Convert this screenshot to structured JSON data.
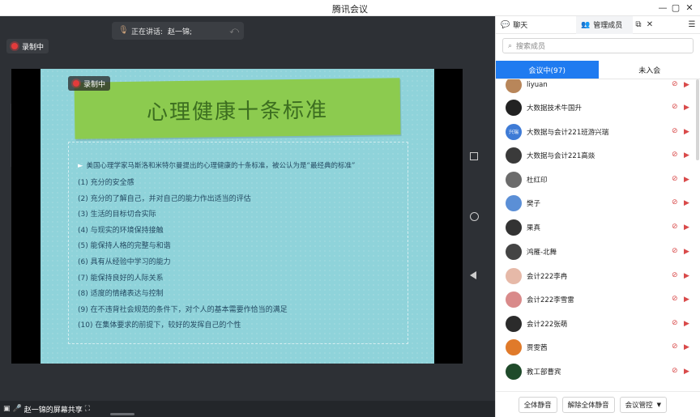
{
  "window": {
    "title": "腾讯会议",
    "controls": [
      "—",
      "▢",
      "✕"
    ]
  },
  "stage": {
    "speaking": {
      "label": "正在讲话:",
      "name": "赵一锦;"
    },
    "recording_label": "录制中",
    "slide": {
      "title": "心理健康十条标准",
      "recording_label": "录制中",
      "intro": "美国心理学家马斯洛和米特尔曼提出的心理健康的十条标准，被公认为是“最经典的标准”",
      "items": [
        "(1)  充分的安全感",
        "(2)  充分的了解自己，并对自己的能力作出适当的评估",
        "(3)  生活的目标切合实际",
        "(4)   与现实的环境保持接触",
        "(5)  能保持人格的完整与和谐",
        "(6)  具有从经验中学习的能力",
        "(7)  能保持良好的人际关系",
        "(8)  适度的情绪表达与控制",
        "(9)  在不违背社会规范的条件下，对个人的基本需要作恰当的满足",
        "(10)     在集体要求的前提下，较好的发挥自己的个性"
      ]
    },
    "footer": {
      "share_text": "赵一锦的屏幕共享"
    }
  },
  "panel": {
    "tabs": {
      "chat": "聊天",
      "members": "管理成员"
    },
    "search_placeholder": "搜索成员",
    "segments": {
      "in_meeting": "会议中(97)",
      "not_joined": "未入会"
    },
    "members": [
      {
        "name": "liyuan",
        "avatar_color": "#b8865a"
      },
      {
        "name": "大数据技术牛国升",
        "avatar_color": "#222222"
      },
      {
        "name": "大数据与会计221班游兴瑞",
        "avatar_color": "#3e7bd6",
        "avatar_text": "兴瑞"
      },
      {
        "name": "大数据与会计221高燚",
        "avatar_color": "#3a3a3a"
      },
      {
        "name": "杜红印",
        "avatar_color": "#6b6b6b"
      },
      {
        "name": "樊子",
        "avatar_color": "#5b8fd6"
      },
      {
        "name": "果真",
        "avatar_color": "#333333"
      },
      {
        "name": "鸿雁-北舞",
        "avatar_color": "#444444"
      },
      {
        "name": "会计222李冉",
        "avatar_color": "#e6b9a8"
      },
      {
        "name": "会计222李雪雷",
        "avatar_color": "#d98a8a"
      },
      {
        "name": "会计222张萌",
        "avatar_color": "#2b2b2b"
      },
      {
        "name": "贾雯茜",
        "avatar_color": "#e07a2a"
      },
      {
        "name": "教工部曹宾",
        "avatar_color": "#1f4a2a"
      }
    ],
    "actions": {
      "mute_all": "全体静音",
      "unmute_all": "解除全体静音",
      "control": "会议管控"
    }
  }
}
